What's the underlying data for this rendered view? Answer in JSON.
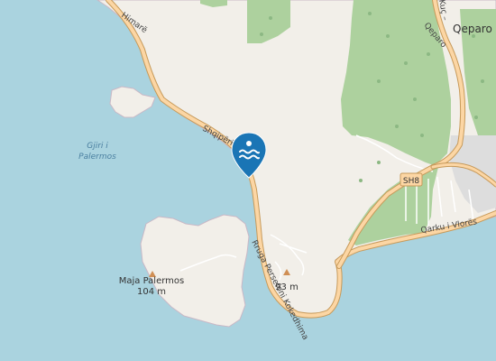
{
  "map": {
    "colors": {
      "sea": "#aad3df",
      "land": "#f2efe9",
      "forest": "#add19e",
      "road_fill": "#fcd6a4",
      "road_casing": "#c79a5a",
      "path": "#ffffff",
      "marker": "#1a75b5"
    },
    "labels": {
      "himare_road": "Himarë",
      "shqiperi_road": "Shqipëri",
      "gjiri_line1": "Gjiri i",
      "gjiri_line2": "Palermos",
      "peak_name": "Maja Palermos",
      "peak_elev": "104 m",
      "hill_elev": "93 m",
      "coastal_road": "Rruga Persefoni Kokedhima",
      "sh8": "SH8",
      "qarku": "Qarku i Vlorës",
      "qeparo_road": "Qeparo",
      "kuq_road": "Kuç –",
      "qeparo_town": "Qeparo"
    },
    "marker": {
      "icon": "swimming-icon"
    }
  }
}
